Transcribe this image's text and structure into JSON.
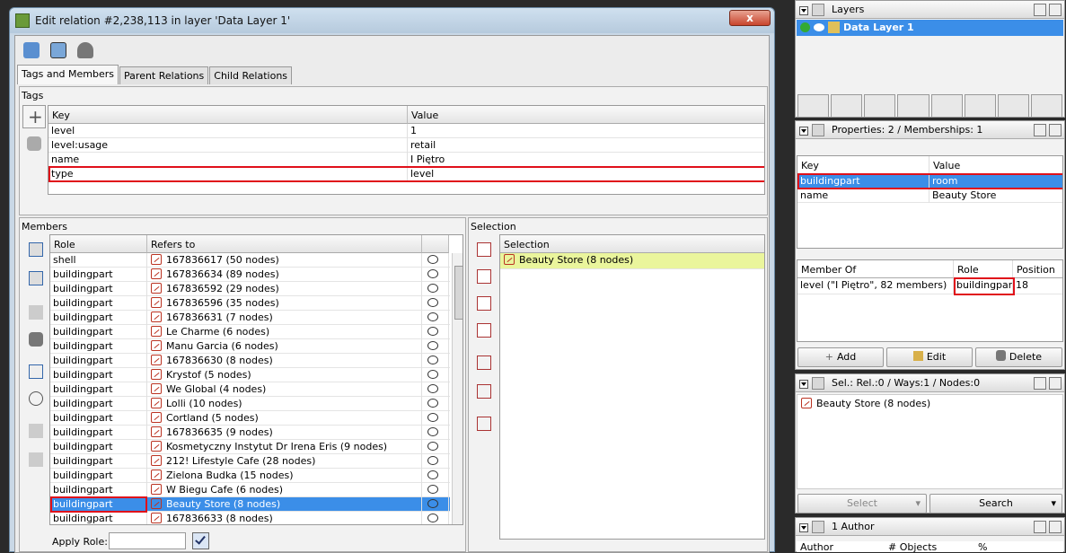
{
  "window": {
    "title": "Edit relation #2,238,113 in layer 'Data Layer 1'",
    "close": "x"
  },
  "tabs": [
    "Tags and Members",
    "Parent Relations",
    "Child Relations"
  ],
  "tags": {
    "label": "Tags",
    "col_key": "Key",
    "col_value": "Value",
    "rows": [
      {
        "k": "level",
        "v": "1"
      },
      {
        "k": "level:usage",
        "v": "retail"
      },
      {
        "k": "name",
        "v": "I Piętro"
      },
      {
        "k": "type",
        "v": "level"
      }
    ]
  },
  "members": {
    "label": "Members",
    "col_role": "Role",
    "col_ref": "Refers to",
    "rows": [
      {
        "r": "shell",
        "t": "167836617 (50 nodes)"
      },
      {
        "r": "buildingpart",
        "t": "167836634 (89 nodes)"
      },
      {
        "r": "buildingpart",
        "t": "167836592 (29 nodes)"
      },
      {
        "r": "buildingpart",
        "t": "167836596 (35 nodes)"
      },
      {
        "r": "buildingpart",
        "t": "167836631 (7 nodes)"
      },
      {
        "r": "buildingpart",
        "t": "Le Charme (6 nodes)"
      },
      {
        "r": "buildingpart",
        "t": "Manu Garcia (6 nodes)"
      },
      {
        "r": "buildingpart",
        "t": "167836630 (8 nodes)"
      },
      {
        "r": "buildingpart",
        "t": "Krystof (5 nodes)"
      },
      {
        "r": "buildingpart",
        "t": "We Global (4 nodes)"
      },
      {
        "r": "buildingpart",
        "t": "Lolli (10 nodes)"
      },
      {
        "r": "buildingpart",
        "t": "Cortland (5 nodes)"
      },
      {
        "r": "buildingpart",
        "t": "167836635 (9 nodes)"
      },
      {
        "r": "buildingpart",
        "t": "Kosmetyczny Instytut Dr Irena Eris (9 nodes)"
      },
      {
        "r": "buildingpart",
        "t": "212! Lifestyle Cafe (28 nodes)"
      },
      {
        "r": "buildingpart",
        "t": "Zielona Budka (15 nodes)"
      },
      {
        "r": "buildingpart",
        "t": "W Biegu Cafe (6 nodes)"
      },
      {
        "r": "buildingpart",
        "t": "Beauty Store (8 nodes)"
      },
      {
        "r": "buildingpart",
        "t": "167836633 (8 nodes)"
      }
    ],
    "apply_role_label": "Apply Role:"
  },
  "selection": {
    "label": "Selection",
    "col": "Selection",
    "item": "Beauty Store (8 nodes)"
  },
  "layers": {
    "title": "Layers",
    "item": "Data Layer 1"
  },
  "properties": {
    "title": "Properties: 2 / Memberships: 1",
    "col_key": "Key",
    "col_value": "Value",
    "rows": [
      {
        "k": "buildingpart",
        "v": "room"
      },
      {
        "k": "name",
        "v": "Beauty Store"
      }
    ],
    "mem_cols": [
      "Member Of",
      "Role",
      "Position"
    ],
    "mem_row": {
      "of": "level (\"I Piętro\", 82 members)",
      "role": "buildingpart",
      "pos": "18"
    },
    "buttons": [
      "Add",
      "Edit",
      "Delete"
    ]
  },
  "selpanel": {
    "title": "Sel.: Rel.:0 / Ways:1 / Nodes:0",
    "item": "Beauty Store (8 nodes)",
    "select": "Select",
    "search": "Search"
  },
  "author": {
    "title": "1 Author",
    "cols": [
      "Author",
      "# Objects",
      "%"
    ]
  }
}
